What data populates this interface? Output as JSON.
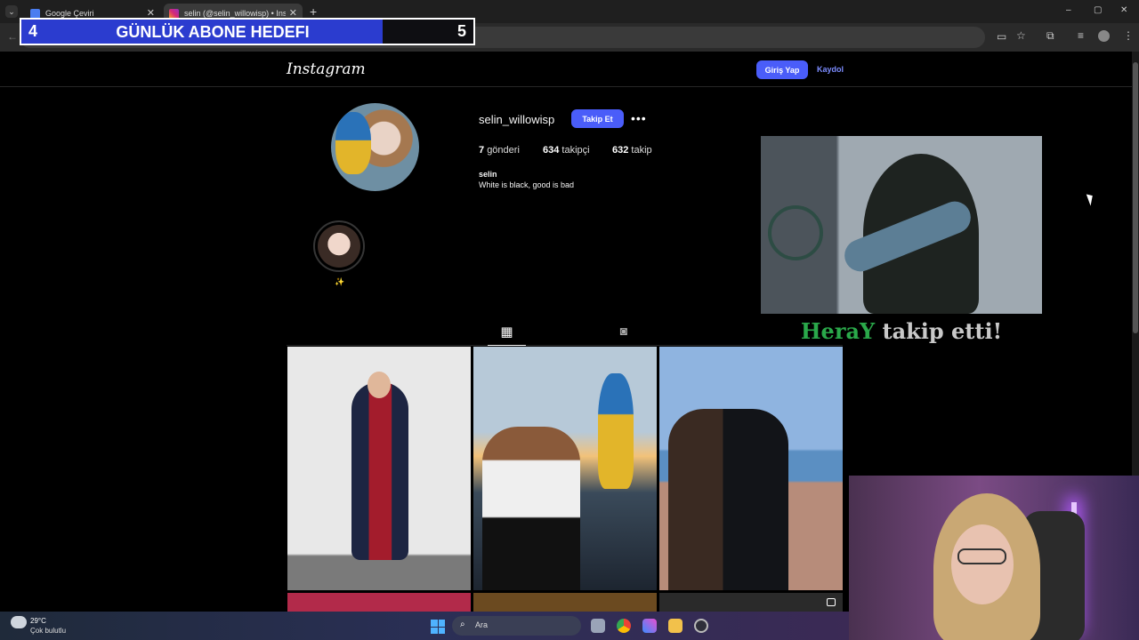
{
  "browser": {
    "tabs": [
      {
        "label": "Google Çeviri",
        "active": false
      },
      {
        "label": "selin (@selin_willowisp) • Instagram",
        "active": true
      }
    ],
    "new_tab": "+",
    "window_controls": {
      "minimize": "–",
      "maximize": "▢",
      "close": "✕"
    }
  },
  "goal_overlay": {
    "current": "4",
    "title": "GÜNLÜK ABONE HEDEFI",
    "target": "5",
    "progress": 0.8
  },
  "instagram": {
    "logo": "Instagram",
    "login_label": "Giriş Yap",
    "signup_label": "Kaydol",
    "profile": {
      "username": "selin_willowisp",
      "follow_label": "Takip Et",
      "more": "•••",
      "posts_count": "7",
      "posts_label": "gönderi",
      "followers_count": "634",
      "followers_label": "takipçi",
      "following_count": "632",
      "following_label": "takip",
      "bio_name": "selin",
      "bio_text": "White is black, good is bad",
      "highlight_label": "✨"
    },
    "tabs": {
      "grid_icon": "▦",
      "tagged_icon": "◙"
    }
  },
  "stream_alert": {
    "name": "HeraY",
    "suffix": " takip etti!"
  },
  "taskbar": {
    "temperature": "29°C",
    "condition": "Çok bulutlu",
    "search_label": "Ara",
    "search_icon": "⌕"
  },
  "colors": {
    "accent": "#4a5df9",
    "goal_fill": "#2b3ccf",
    "alert_name": "#2aa84a"
  }
}
